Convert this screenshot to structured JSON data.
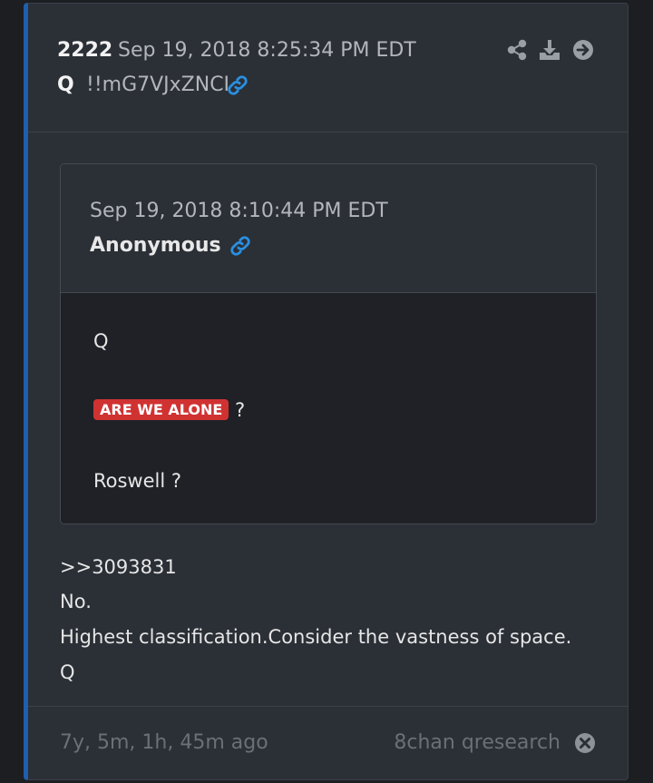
{
  "post": {
    "number": "2222",
    "date": "Sep 19, 2018 8:25:34 PM EDT",
    "author": "Q",
    "tripcode": "!!mG7VJxZNCI"
  },
  "quoted": {
    "date": "Sep 19, 2018 8:10:44 PM EDT",
    "author": "Anonymous",
    "lines": {
      "line1": "Q",
      "badge": "ARE WE ALONE",
      "badge_suffix": "?",
      "line3": "Roswell ?"
    }
  },
  "message": {
    "ref": ">>3093831",
    "line2": "No.",
    "line3": "Highest classification.Consider the vastness of space.",
    "line4": "Q"
  },
  "footer": {
    "age": "7y, 5m, 1h, 45m ago",
    "source": "8chan qresearch"
  },
  "colors": {
    "accent_border": "#1f5fae",
    "link_icon": "#2a8fe0",
    "badge_bg": "#d03232"
  },
  "icons": [
    "share-icon",
    "download-icon",
    "arrow-right-icon",
    "link-icon",
    "close-icon"
  ]
}
